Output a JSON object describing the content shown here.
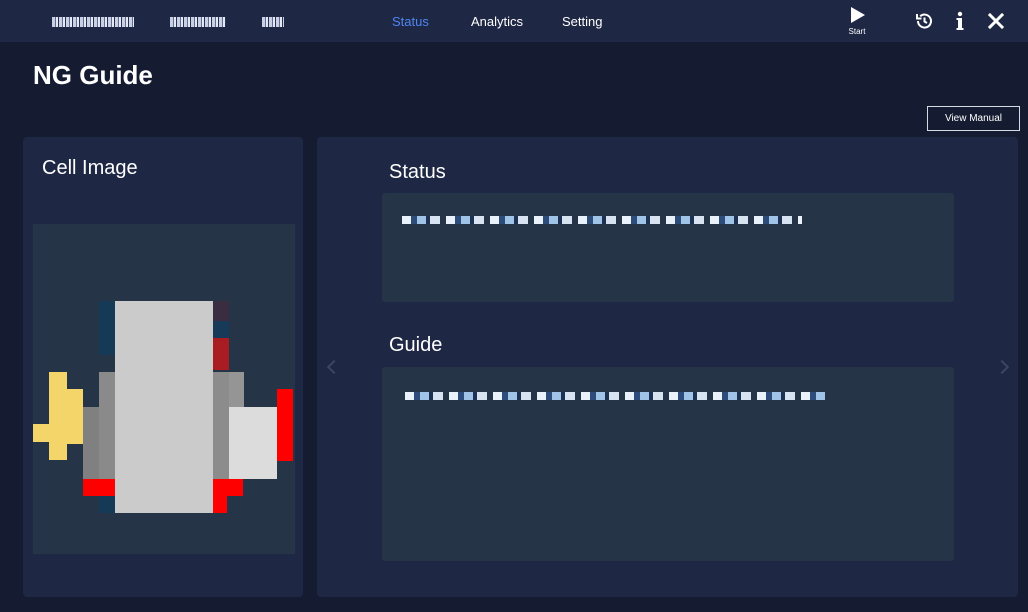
{
  "nav": {
    "tabs": [
      {
        "label": "Status",
        "active": true
      },
      {
        "label": "Analytics",
        "active": false
      },
      {
        "label": "Setting",
        "active": false
      }
    ]
  },
  "toolbar": {
    "start_label": "Start",
    "icons": [
      "play-icon",
      "history-icon",
      "info-icon",
      "close-icon"
    ]
  },
  "page": {
    "title": "NG Guide",
    "view_manual_label": "View Manual"
  },
  "left_panel": {
    "title": "Cell Image"
  },
  "right_panel": {
    "status_heading": "Status",
    "guide_heading": "Guide"
  },
  "colors": {
    "background": "#151c31",
    "panel": "#1e2744",
    "textbox": "#253447",
    "accent": "#4f86f0"
  }
}
